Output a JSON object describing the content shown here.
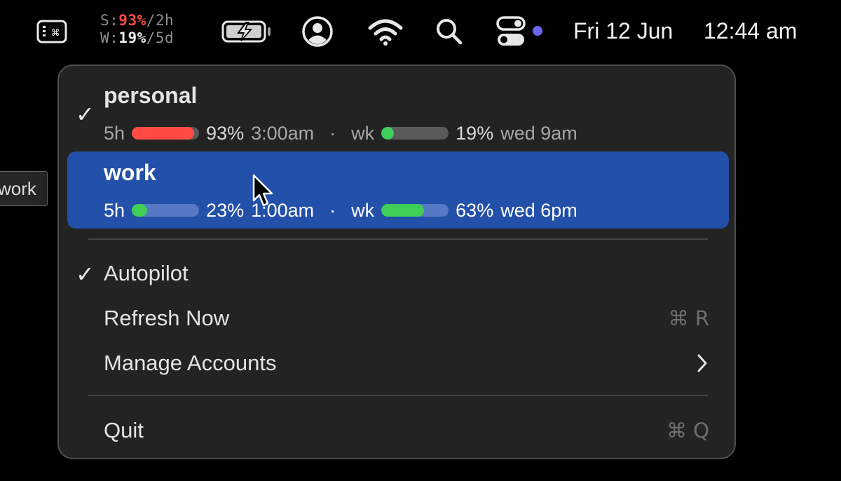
{
  "menubar": {
    "usage": {
      "session_prefix": "S:",
      "session_pct": "93%",
      "session_suffix": "/2h",
      "week_prefix": "W:",
      "week_pct": "19%",
      "week_suffix": "/5d"
    },
    "icons": [
      "keyboard-icon",
      "battery-charging-icon",
      "user-circle-icon",
      "wifi-icon",
      "search-icon",
      "control-center-icon"
    ],
    "date": "Fri 12 Jun",
    "time": "12:44 am",
    "indicator_color": "#6a66f2"
  },
  "side_tooltip": "work",
  "menu": {
    "accounts": [
      {
        "name": "personal",
        "checked": true,
        "short_label": "5h",
        "short_progress": 0.93,
        "short_pct": "93%",
        "short_reset": "3:00am",
        "separator": "·",
        "week_label": "wk",
        "week_progress": 0.19,
        "week_pct": "19%",
        "week_reset": "wed 9am"
      },
      {
        "name": "work",
        "checked": false,
        "highlighted": true,
        "short_label": "5h",
        "short_progress": 0.23,
        "short_pct": "23%",
        "short_reset": "1:00am",
        "separator": "·",
        "week_label": "wk",
        "week_progress": 0.63,
        "week_pct": "63%",
        "week_reset": "wed 6pm"
      }
    ],
    "check_glyph": "✓",
    "autopilot": {
      "label": "Autopilot",
      "checked": true
    },
    "refresh": {
      "label": "Refresh Now",
      "shortcut": "⌘ R"
    },
    "manage": {
      "label": "Manage Accounts"
    },
    "quit": {
      "label": "Quit",
      "shortcut": "⌘ Q"
    }
  },
  "colors": {
    "danger": "#ff4b44",
    "ok": "#3fcf56",
    "highlight": "#2350a8",
    "menu_bg": "#232323"
  }
}
